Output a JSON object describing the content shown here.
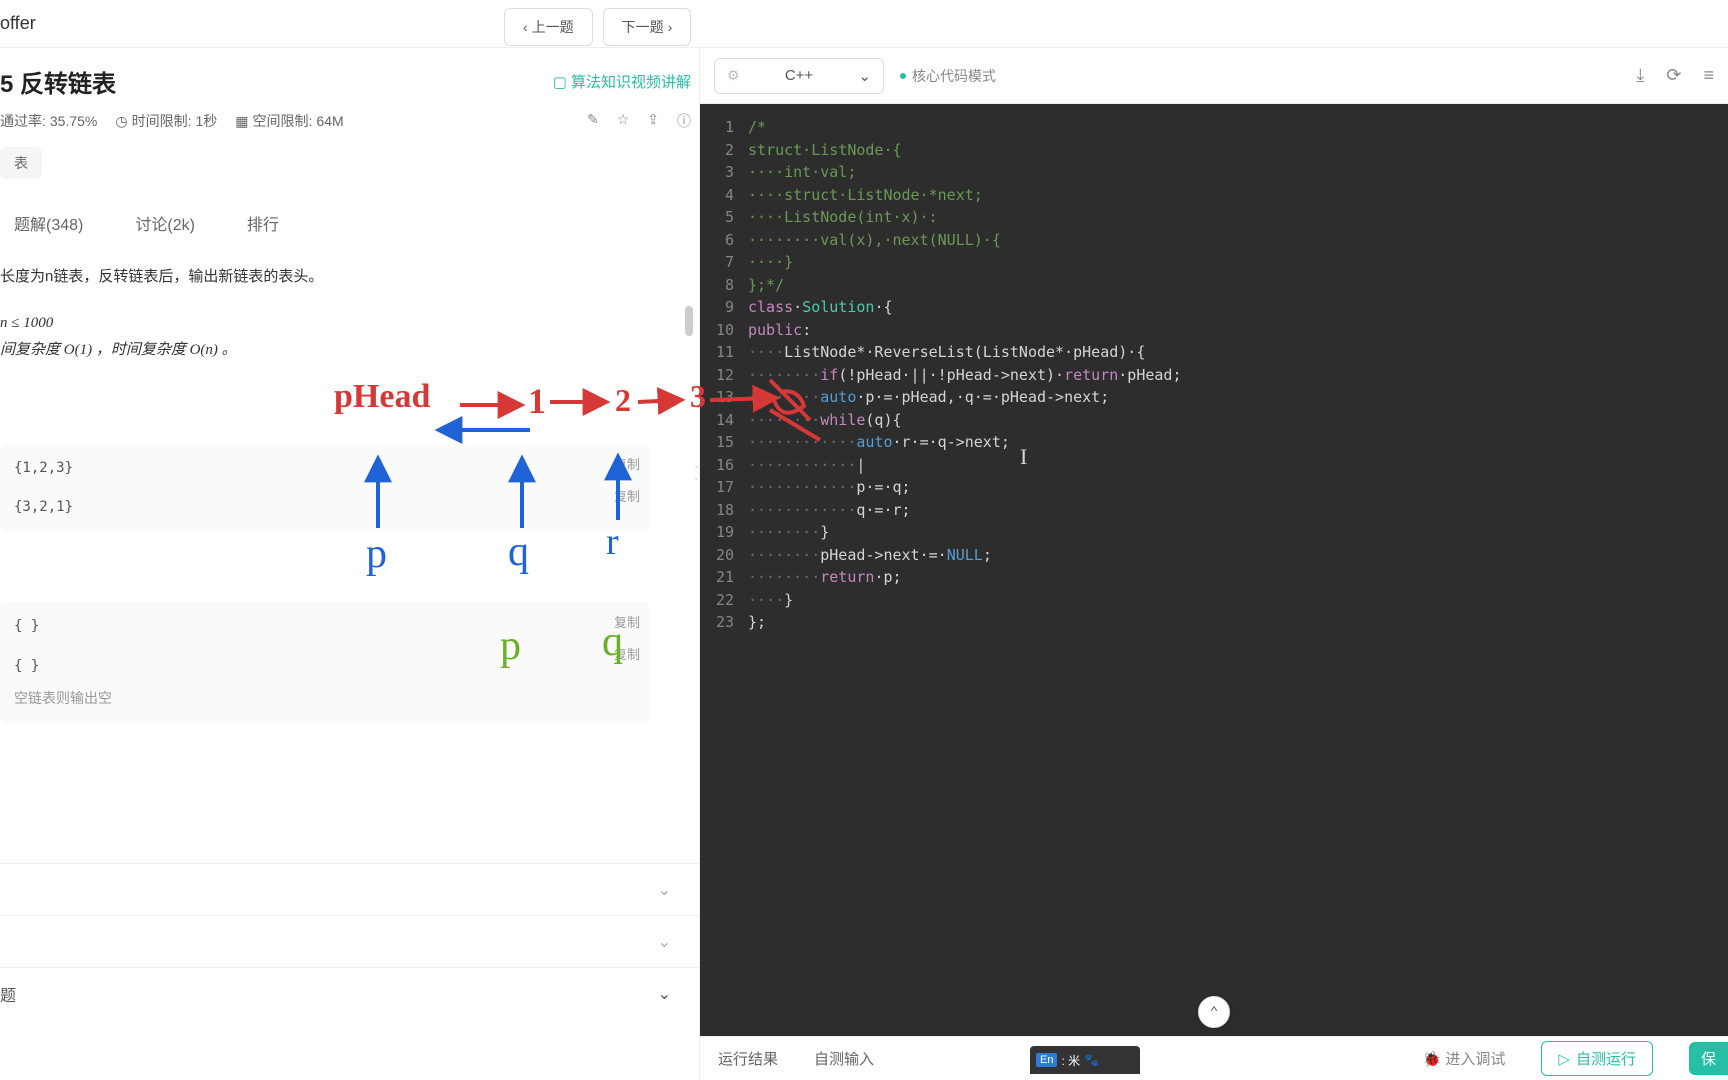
{
  "brand": "offer",
  "nav": {
    "prev": "上一题",
    "next": "下一题"
  },
  "problem": {
    "number_title": "5  反转链表",
    "video_link": "算法知识视频讲解",
    "pass_rate_label": "通过率:",
    "pass_rate": "35.75%",
    "time_limit_label": "时间限制:",
    "time_limit": "1秒",
    "space_limit_label": "空间限制:",
    "space_limit": "64M",
    "tag": "表",
    "tabs": {
      "solutions": "题解(348)",
      "discuss": "讨论(2k)",
      "rank": "排行"
    },
    "desc_line": "长度为n链表，反转链表后，输出新链表的表头。",
    "constraint": "n ≤ 1000",
    "complexity": "间复杂度 O(1) ，时间复杂度 O(n) 。",
    "example1_in": "{1,2,3}",
    "example1_out": "{3,2,1}",
    "example2_in": "{ }",
    "example2_out": "{ }",
    "empty_note": "空链表则输出空",
    "copy": "复制",
    "expand_last": "题"
  },
  "editor": {
    "language": "C++",
    "mode": "核心代码模式",
    "lines": [
      {
        "n": 1,
        "segs": [
          {
            "c": "c-com",
            "t": "/*"
          }
        ]
      },
      {
        "n": 2,
        "segs": [
          {
            "c": "c-com",
            "t": "struct·ListNode·{"
          }
        ]
      },
      {
        "n": 3,
        "segs": [
          {
            "c": "c-com",
            "t": "····int·val;"
          }
        ]
      },
      {
        "n": 4,
        "segs": [
          {
            "c": "c-com",
            "t": "····struct·ListNode·*next;"
          }
        ]
      },
      {
        "n": 5,
        "segs": [
          {
            "c": "c-com",
            "t": "····ListNode(int·x)·:"
          }
        ]
      },
      {
        "n": 6,
        "segs": [
          {
            "c": "c-com",
            "t": "········val(x),·next(NULL)·{"
          }
        ]
      },
      {
        "n": 7,
        "segs": [
          {
            "c": "c-com",
            "t": "····}"
          }
        ]
      },
      {
        "n": 8,
        "segs": [
          {
            "c": "c-com",
            "t": "};*/"
          }
        ]
      },
      {
        "n": 9,
        "segs": [
          {
            "c": "c-kw",
            "t": "class"
          },
          {
            "c": "c-txt",
            "t": "·"
          },
          {
            "c": "c-cls",
            "t": "Solution"
          },
          {
            "c": "c-txt",
            "t": "·{"
          }
        ]
      },
      {
        "n": 10,
        "segs": [
          {
            "c": "c-kw",
            "t": "public"
          },
          {
            "c": "c-txt",
            "t": ":"
          }
        ]
      },
      {
        "n": 11,
        "segs": [
          {
            "c": "c-dot",
            "t": "····"
          },
          {
            "c": "c-txt",
            "t": "ListNode*·ReverseList(ListNode*·pHead)·{"
          }
        ]
      },
      {
        "n": 12,
        "segs": [
          {
            "c": "c-dot",
            "t": "········"
          },
          {
            "c": "c-kw",
            "t": "if"
          },
          {
            "c": "c-txt",
            "t": "(!pHead·||·!pHead->next)·"
          },
          {
            "c": "c-kw",
            "t": "return"
          },
          {
            "c": "c-txt",
            "t": "·pHead;"
          }
        ]
      },
      {
        "n": 13,
        "segs": [
          {
            "c": "c-dot",
            "t": "········"
          },
          {
            "c": "c-type",
            "t": "auto"
          },
          {
            "c": "c-txt",
            "t": "·p·=·pHead,·q·=·pHead->next;"
          }
        ]
      },
      {
        "n": 14,
        "segs": [
          {
            "c": "c-dot",
            "t": "········"
          },
          {
            "c": "c-kw",
            "t": "while"
          },
          {
            "c": "c-txt",
            "t": "(q){"
          }
        ]
      },
      {
        "n": 15,
        "segs": [
          {
            "c": "c-dot",
            "t": "············"
          },
          {
            "c": "c-type",
            "t": "auto"
          },
          {
            "c": "c-txt",
            "t": "·r·=·q->next;"
          }
        ]
      },
      {
        "n": 16,
        "segs": [
          {
            "c": "c-dot",
            "t": "············"
          },
          {
            "c": "cursor-bar",
            "t": "|"
          }
        ]
      },
      {
        "n": 17,
        "segs": [
          {
            "c": "c-dot",
            "t": "············"
          },
          {
            "c": "c-txt",
            "t": "p·=·q;"
          }
        ]
      },
      {
        "n": 18,
        "segs": [
          {
            "c": "c-dot",
            "t": "············"
          },
          {
            "c": "c-txt",
            "t": "q·=·r;"
          }
        ]
      },
      {
        "n": 19,
        "segs": [
          {
            "c": "c-dot",
            "t": "········"
          },
          {
            "c": "c-txt",
            "t": "}"
          }
        ]
      },
      {
        "n": 20,
        "segs": [
          {
            "c": "c-dot",
            "t": "········"
          },
          {
            "c": "c-txt",
            "t": "pHead->next·=·"
          },
          {
            "c": "c-null",
            "t": "NULL"
          },
          {
            "c": "c-txt",
            "t": ";"
          }
        ]
      },
      {
        "n": 21,
        "segs": [
          {
            "c": "c-dot",
            "t": "········"
          },
          {
            "c": "c-kw",
            "t": "return"
          },
          {
            "c": "c-txt",
            "t": "·p;"
          }
        ]
      },
      {
        "n": 22,
        "segs": [
          {
            "c": "c-dot",
            "t": "····"
          },
          {
            "c": "c-txt",
            "t": "}"
          }
        ]
      },
      {
        "n": 23,
        "segs": [
          {
            "c": "c-txt",
            "t": "};"
          }
        ]
      }
    ]
  },
  "bottom": {
    "run_result": "运行结果",
    "self_test_input": "自测输入",
    "debug": "进入调试",
    "test_run": "自测运行",
    "submit": "保"
  },
  "ime": {
    "en": "En",
    "text": ": 米"
  },
  "annotations": {
    "phead": "pHead",
    "nums": [
      "1",
      "2",
      "3"
    ],
    "p": "p",
    "q": "q",
    "r": "r"
  }
}
